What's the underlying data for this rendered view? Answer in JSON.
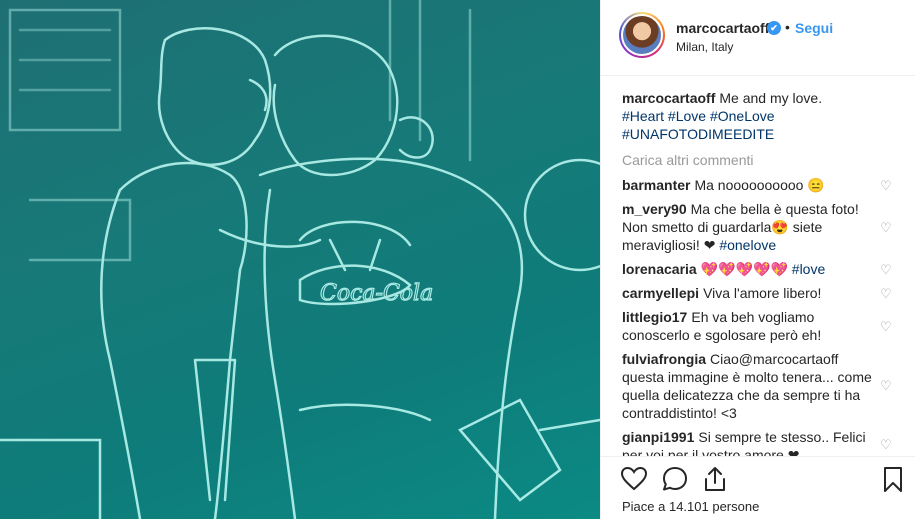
{
  "post": {
    "photo_alt": "",
    "header": {
      "username": "marcocartaoff",
      "verified_mark": "✔",
      "separator": "•",
      "follow_label": "Segui",
      "location": "Milan, Italy"
    },
    "caption": {
      "username": "marcocartaoff",
      "text": "Me and my love.",
      "tags": [
        "#Heart",
        "#Love",
        "#OneLove",
        "#UNAFOTODIMEEDITE"
      ]
    },
    "load_more_label": "Carica altri commenti",
    "comments": [
      {
        "username": "barmanter",
        "text": "Ma noooooooooo 😑"
      },
      {
        "username": "m_very90",
        "text": "Ma che bella è questa foto! Non smetto di guardarla😍 siete meravigliosi! ❤",
        "tag": "#onelove"
      },
      {
        "username": "lorenacaria",
        "text": "💖💖💖💖💖",
        "tag": "#love"
      },
      {
        "username": "carmyellepi",
        "text": "Viva l'amore libero!"
      },
      {
        "username": "littlegio17",
        "text": "Eh va beh vogliamo conoscerlo e sgolosare però eh!"
      },
      {
        "username": "fulviafrongia",
        "text": "Ciao@marcocartaoff questa immagine è molto tenera... come quella delicatezza che da sempre ti ha contraddistinto! <3"
      },
      {
        "username": "gianpi1991",
        "text": "Si sempre te stesso.. Felici per voi per il vostro amore ❤"
      }
    ],
    "comment_like_icon": "heart-outline-icon",
    "likes_text": "Piace a 14.101 persone",
    "colors": {
      "link_blue": "#3897f0",
      "tag_blue": "#003569",
      "photo_teal": "#177a78",
      "photo_lines": "#b9f5f0"
    }
  }
}
